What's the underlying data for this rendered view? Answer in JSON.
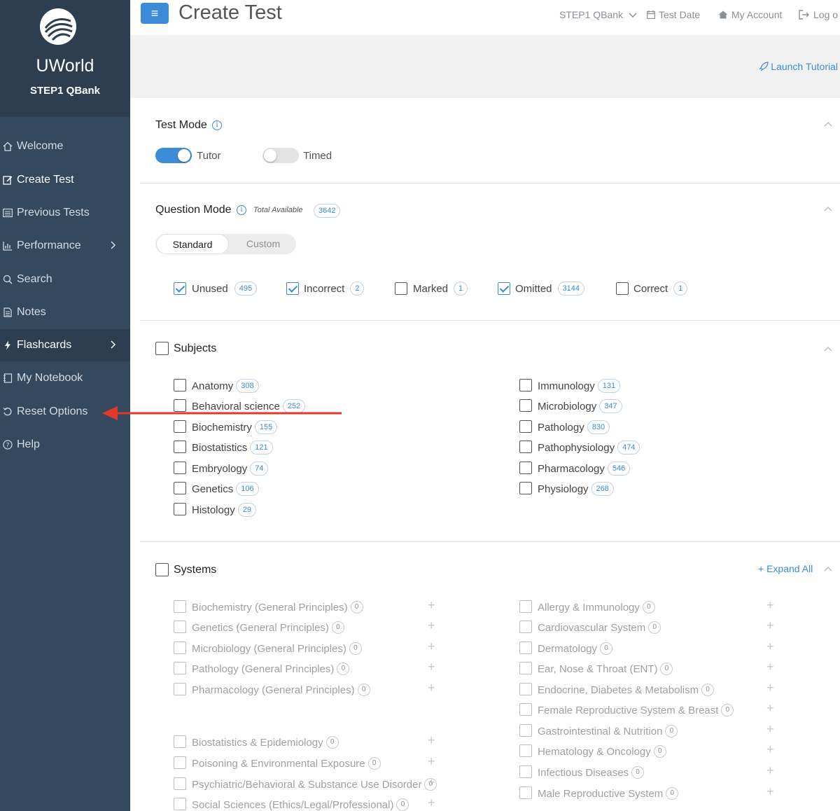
{
  "app": {
    "brand": "UWorld",
    "product": "STEP1 QBank"
  },
  "colors": {
    "accent": "#3b8bd8",
    "sidebar": "#34495e",
    "sidebar_dark": "#2c3e50",
    "annotation_arrow": "#e2392b"
  },
  "sidebar": {
    "items": [
      {
        "label": "Welcome",
        "icon": "home-icon"
      },
      {
        "label": "Create Test",
        "icon": "edit-icon"
      },
      {
        "label": "Previous Tests",
        "icon": "list-icon"
      },
      {
        "label": "Performance",
        "icon": "bar-chart-icon"
      },
      {
        "label": "Search",
        "icon": "search-icon"
      },
      {
        "label": "Notes",
        "icon": "note-icon"
      },
      {
        "label": "Flashcards",
        "icon": "bolt-icon"
      },
      {
        "label": "My Notebook",
        "icon": "notebook-icon"
      },
      {
        "label": "Reset Options",
        "icon": "reset-icon"
      },
      {
        "label": "Help",
        "icon": "help-icon"
      }
    ]
  },
  "header": {
    "menu_icon": "≡",
    "title": "Create Test",
    "qbank": "STEP1 QBank",
    "test_date": "Test Date",
    "my_account": "My Account",
    "logout": "Log o"
  },
  "subbar": {
    "tutorial": "Launch Tutorial"
  },
  "test_mode": {
    "title": "Test Mode",
    "tutor": "Tutor",
    "timed": "Timed",
    "tutor_on": true,
    "timed_on": false
  },
  "question_mode": {
    "title": "Question Mode",
    "total_label": "Total Available",
    "total": "3642",
    "standard": "Standard",
    "custom": "Custom",
    "filters": [
      {
        "label": "Unused",
        "count": "495",
        "checked": true
      },
      {
        "label": "Incorrect",
        "count": "2",
        "checked": true
      },
      {
        "label": "Marked",
        "count": "1",
        "checked": false
      },
      {
        "label": "Omitted",
        "count": "3144",
        "checked": true
      },
      {
        "label": "Correct",
        "count": "1",
        "checked": false
      }
    ]
  },
  "subjects": {
    "title": "Subjects",
    "left": [
      {
        "label": "Anatomy",
        "count": "308"
      },
      {
        "label": "Behavioral science",
        "count": "252"
      },
      {
        "label": "Biochemistry",
        "count": "155"
      },
      {
        "label": "Biostatistics",
        "count": "121"
      },
      {
        "label": "Embryology",
        "count": "74"
      },
      {
        "label": "Genetics",
        "count": "106"
      },
      {
        "label": "Histology",
        "count": "29"
      }
    ],
    "right": [
      {
        "label": "Immunology",
        "count": "131"
      },
      {
        "label": "Microbiology",
        "count": "347"
      },
      {
        "label": "Pathology",
        "count": "830"
      },
      {
        "label": "Pathophysiology",
        "count": "474"
      },
      {
        "label": "Pharmacology",
        "count": "546"
      },
      {
        "label": "Physiology",
        "count": "268"
      }
    ]
  },
  "systems": {
    "title": "Systems",
    "expand_all": "+ Expand All",
    "left": [
      {
        "label": "Biochemistry (General Principles)",
        "count": "0"
      },
      {
        "label": "Genetics (General Principles)",
        "count": "0"
      },
      {
        "label": "Microbiology (General Principles)",
        "count": "0"
      },
      {
        "label": "Pathology (General Principles)",
        "count": "0"
      },
      {
        "label": "Pharmacology (General Principles)",
        "count": "0"
      },
      {
        "label": "Biostatistics & Epidemiology",
        "count": "0"
      },
      {
        "label": "Poisoning & Environmental Exposure",
        "count": "0"
      },
      {
        "label": "Psychiatric/Behavioral & Substance Use Disorder",
        "count": "0"
      },
      {
        "label": "Social Sciences (Ethics/Legal/Professional)",
        "count": "0"
      }
    ],
    "right": [
      {
        "label": "Allergy & Immunology",
        "count": "0"
      },
      {
        "label": "Cardiovascular System",
        "count": "0"
      },
      {
        "label": "Dermatology",
        "count": "0"
      },
      {
        "label": "Ear, Nose & Throat (ENT)",
        "count": "0"
      },
      {
        "label": "Endocrine, Diabetes & Metabolism",
        "count": "0"
      },
      {
        "label": "Female Reproductive System & Breast",
        "count": "0"
      },
      {
        "label": "Gastrointestinal & Nutrition",
        "count": "0"
      },
      {
        "label": "Hematology & Oncology",
        "count": "0"
      },
      {
        "label": "Infectious Diseases",
        "count": "0"
      },
      {
        "label": "Male Reproductive System",
        "count": "0"
      }
    ]
  }
}
